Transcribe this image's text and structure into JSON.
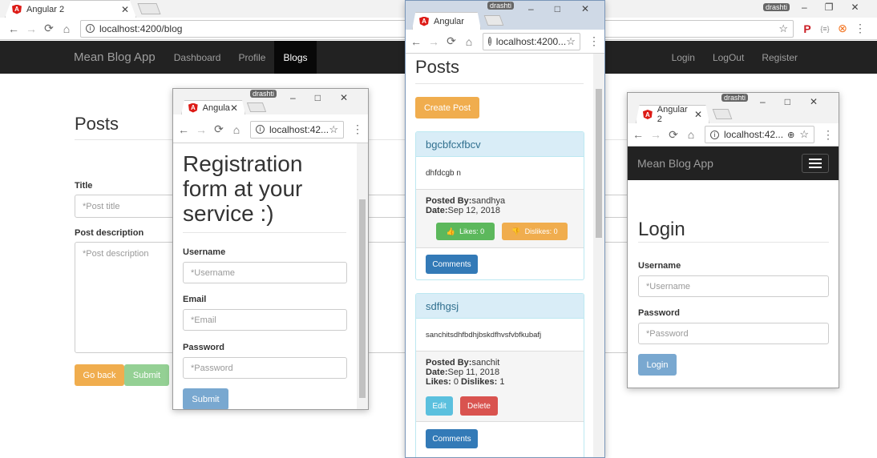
{
  "main_window": {
    "tab_title": "Angular 2",
    "user_badge": "drashti",
    "url": "localhost:4200/blog",
    "navbar": {
      "brand": "Mean Blog App",
      "links": [
        "Dashboard",
        "Profile",
        "Blogs"
      ],
      "active": "Blogs",
      "right_links": [
        "Login",
        "LogOut",
        "Register"
      ]
    },
    "page_title": "Posts",
    "form": {
      "title_label": "Title",
      "title_placeholder": "*Post title",
      "desc_label": "Post description",
      "desc_placeholder": "*Post description",
      "go_back": "Go back",
      "submit": "Submit"
    }
  },
  "registration_window": {
    "tab_title": "Angula",
    "user_badge": "drashti",
    "url": "localhost:42...",
    "heading_lines": [
      "Registration",
      "form at your",
      "service :)"
    ],
    "username_label": "Username",
    "username_placeholder": "*Username",
    "email_label": "Email",
    "email_placeholder": "*Email",
    "password_label": "Password",
    "password_placeholder": "*Password",
    "submit": "Submit"
  },
  "posts_window": {
    "tab_title": "Angular",
    "user_badge": "drashti",
    "url": "localhost:4200...",
    "page_title": "Posts",
    "create_post": "Create Post",
    "posts": [
      {
        "title": "bgcbfcxfbcv",
        "body": "dhfdcgb n",
        "posted_by_label": "Posted By:",
        "posted_by": "sandhya",
        "date_label": "Date:",
        "date": "Sep 12, 2018",
        "likes_btn": "Likes: 0",
        "dislikes_btn": "Dislikes: 0",
        "comments": "Comments"
      },
      {
        "title": "sdfhgsj",
        "body": "sanchitsdhfbdhjbskdfhvsfvbfkubafj",
        "posted_by_label": "Posted By:",
        "posted_by": "sanchit",
        "date_label": "Date:",
        "date": "Sep 11, 2018",
        "likes_label": "Likes:",
        "likes": "0",
        "dislikes_label": "Dislikes:",
        "dislikes": "1",
        "edit": "Edit",
        "delete": "Delete",
        "comments": "Comments"
      }
    ]
  },
  "login_window": {
    "tab_title": "Angular 2",
    "user_badge": "drashti",
    "url": "localhost:42...",
    "brand": "Mean Blog App",
    "page_title": "Login",
    "username_label": "Username",
    "username_placeholder": "*Username",
    "password_label": "Password",
    "password_placeholder": "*Password",
    "login_button": "Login"
  },
  "colors": {
    "navbar_bg": "#222222",
    "primary": "#337ab7",
    "warning": "#f0ad4e",
    "success": "#5cb85c",
    "info": "#5bc0de",
    "danger": "#d9534f"
  }
}
